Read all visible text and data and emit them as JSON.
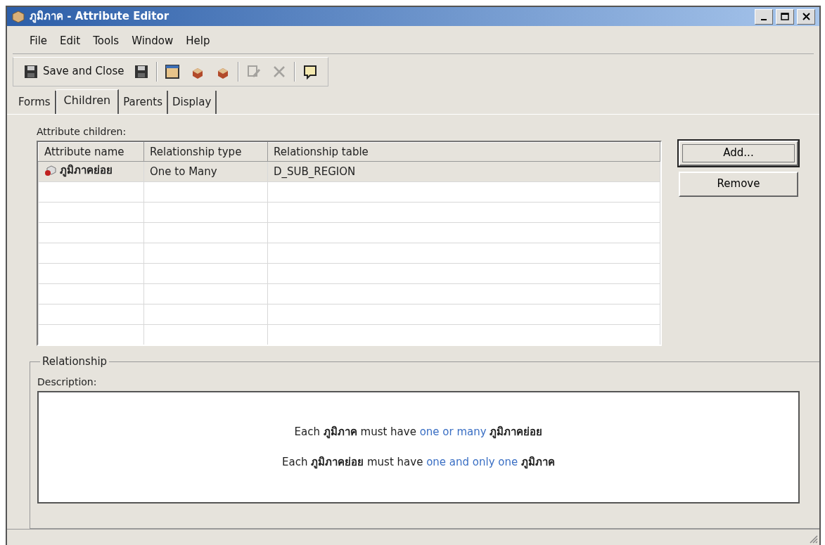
{
  "window": {
    "title": "ภูมิภาค - Attribute Editor"
  },
  "menu": [
    "File",
    "Edit",
    "Tools",
    "Window",
    "Help"
  ],
  "toolbar": [
    {
      "kind": "text-button",
      "label": "Save and Close",
      "disabled": false
    },
    {
      "kind": "icon",
      "disabled": false
    },
    {
      "kind": "separator"
    },
    {
      "kind": "icon",
      "disabled": false
    },
    {
      "kind": "icon",
      "disabled": false
    },
    {
      "kind": "icon",
      "disabled": false
    },
    {
      "kind": "separator"
    },
    {
      "kind": "icon",
      "disabled": true
    },
    {
      "kind": "icon",
      "disabled": true
    },
    {
      "kind": "separator"
    },
    {
      "kind": "icon",
      "disabled": false
    }
  ],
  "tabs": [
    {
      "label": "Forms",
      "selected": false
    },
    {
      "label": "Children",
      "selected": true
    },
    {
      "label": "Parents",
      "selected": false
    },
    {
      "label": "Display",
      "selected": false
    }
  ],
  "children_label": "Attribute children:",
  "table": {
    "columns": [
      "Attribute name",
      "Relationship type",
      "Relationship table"
    ],
    "rows": [
      [
        "ภูมิภาคย่อย",
        "One to Many",
        "D_SUB_REGION"
      ]
    ]
  },
  "buttons": [
    {
      "label": "Add...",
      "focused": true
    },
    {
      "label": "Remove",
      "focused": false
    }
  ],
  "relationship": {
    "title": "Relationship",
    "description_label": "Description:",
    "lines": [
      [
        {
          "kind": "text",
          "text": "Each **ภูมิภาค** must have "
        },
        {
          "kind": "link",
          "text": "one or many"
        },
        {
          "kind": "text",
          "text": " **ภูมิภาคย่อย**"
        }
      ],
      [
        {
          "kind": "text",
          "text": "Each **ภูมิภาคย่อย** must have "
        },
        {
          "kind": "link",
          "text": "one and only one"
        },
        {
          "kind": "text",
          "text": " **ภูมิภาค**"
        }
      ]
    ]
  }
}
